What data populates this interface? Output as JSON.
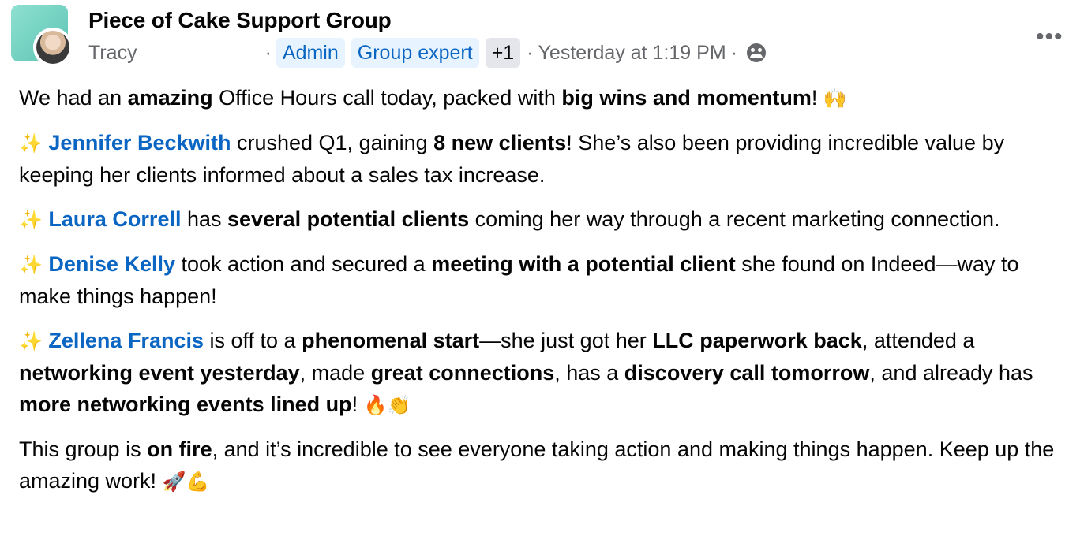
{
  "header": {
    "group_name": "Piece of Cake Support Group",
    "author": "Tracy",
    "separator": "·",
    "badges": [
      "Admin",
      "Group expert"
    ],
    "badge_more": "+1",
    "timestamp": "Yesterday at 1:19 PM",
    "more_label": "•••"
  },
  "post": {
    "p1": {
      "a": "We had an ",
      "b": "amazing",
      "c": " Office Hours call today, packed with ",
      "d": "big wins and momentum",
      "e": "! ",
      "emoji": "🙌"
    },
    "p2": {
      "spark": "✨",
      "mention": "Jennifer Beckwith",
      "a": " crushed Q1, gaining ",
      "b": "8 new clients",
      "c": "! She’s also been providing incredible value by keeping her clients informed about a sales tax increase."
    },
    "p3": {
      "spark": "✨",
      "mention": "Laura Correll",
      "a": " has ",
      "b": "several potential clients",
      "c": " coming her way through a recent marketing connection."
    },
    "p4": {
      "spark": "✨",
      "mention": "Denise Kelly",
      "a": " took action and secured a ",
      "b": "meeting with a potential client",
      "c": " she found on Indeed—way to make things happen!"
    },
    "p5": {
      "spark": "✨",
      "mention": "Zellena Francis",
      "a": " is off to a ",
      "b": "phenomenal start",
      "c": "—she just got her ",
      "d": "LLC paperwork back",
      "e": ", attended a ",
      "f": "networking event yesterday",
      "g": ", made ",
      "h": "great connections",
      "i": ", has a ",
      "j": "discovery call tomorrow",
      "k": ", and already has ",
      "l": "more networking events lined up",
      "m": "! ",
      "emoji": "🔥👏"
    },
    "p6": {
      "a": "This group is ",
      "b": "on fire",
      "c": ", and it’s incredible to see everyone taking action and making things happen. Keep up the amazing work! ",
      "emoji": "🚀💪"
    }
  },
  "colors": {
    "link": "#0a66c2",
    "badge_bg": "#e7f3ff",
    "muted": "#65676b"
  }
}
